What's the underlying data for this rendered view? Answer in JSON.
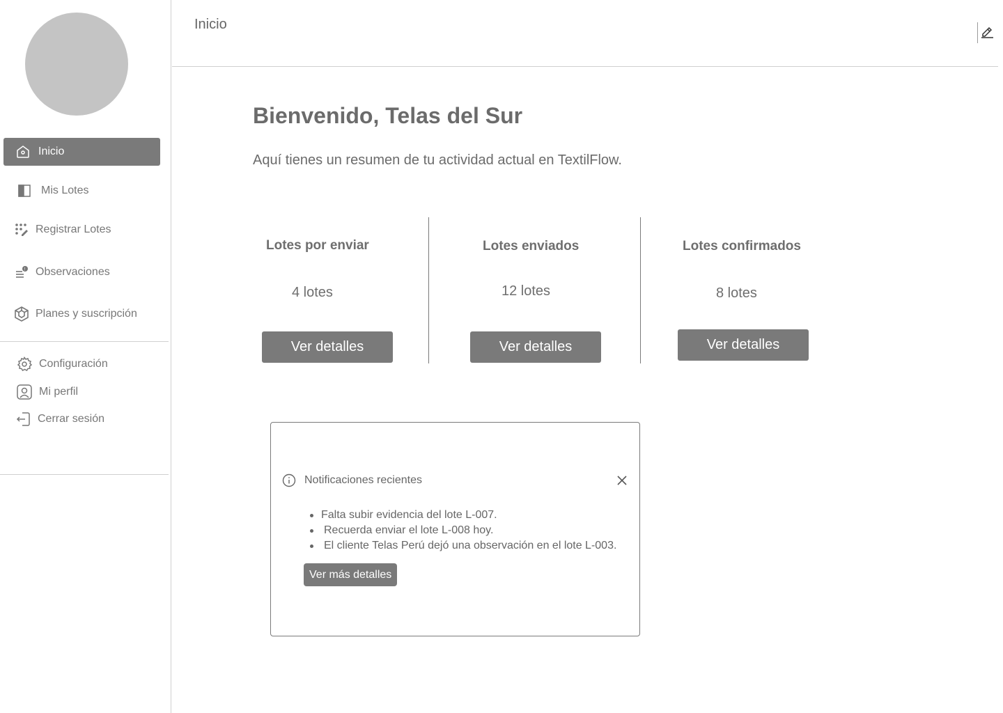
{
  "header": {
    "title": "Inicio"
  },
  "sidebar": {
    "items": [
      {
        "label": "Inicio",
        "icon": "home-icon"
      },
      {
        "label": "Mis Lotes",
        "icon": "book-icon"
      },
      {
        "label": "Registrar Lotes",
        "icon": "grid-edit-icon"
      },
      {
        "label": "Observaciones",
        "icon": "list-alert-icon"
      },
      {
        "label": "Planes y suscripción",
        "icon": "cube-icon"
      }
    ],
    "footer_items": [
      {
        "label": "Configuración",
        "icon": "gear-icon"
      },
      {
        "label": "Mi perfil",
        "icon": "user-icon"
      },
      {
        "label": "Cerrar sesión",
        "icon": "logout-icon"
      }
    ]
  },
  "main": {
    "welcome": "Bienvenido, Telas del Sur",
    "subtitle": "Aquí tienes un resumen de tu actividad actual en TextilFlow.",
    "stats": [
      {
        "title": "Lotes por enviar",
        "value": "4 lotes",
        "button": "Ver detalles"
      },
      {
        "title": "Lotes enviados",
        "value": "12 lotes",
        "button": "Ver detalles"
      },
      {
        "title": "Lotes confirmados",
        "value": "8 lotes",
        "button": "Ver detalles"
      }
    ],
    "notifications": {
      "title": "Notificaciones recientes",
      "items": [
        "Falta subir evidencia del lote L-007.",
        "Recuerda enviar el lote L-008 hoy.",
        "El cliente Telas Perú dejó una observación en el lote L-003."
      ],
      "button": "Ver más detalles"
    }
  },
  "colors": {
    "accent": "#7a7a7a",
    "avatar": "#c4c4c4",
    "border": "#d0d0d0"
  }
}
